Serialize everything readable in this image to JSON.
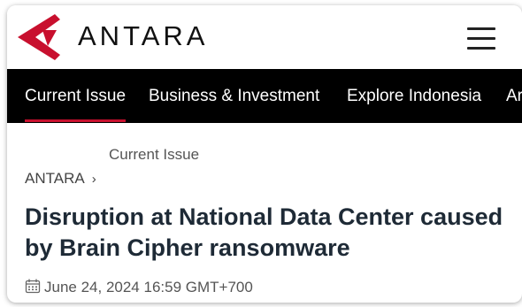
{
  "header": {
    "logo_text": "ANTARA",
    "menu_icon": "hamburger-menu-icon",
    "brand_color": "#c8102e"
  },
  "nav": {
    "items": [
      {
        "label": "Current Issue",
        "active": true
      },
      {
        "label": "Business & Investment",
        "active": false
      },
      {
        "label": "Explore Indonesia",
        "active": false
      },
      {
        "label": "Ar",
        "active": false
      }
    ],
    "background": "#000000"
  },
  "article": {
    "section": "Current Issue",
    "breadcrumb": {
      "root": "ANTARA",
      "separator": "›"
    },
    "title": "Disruption at National Data Center caused by Brain Cipher ransomware",
    "date": "June 24, 2024 16:59 GMT+700",
    "date_icon": "calendar-icon"
  }
}
